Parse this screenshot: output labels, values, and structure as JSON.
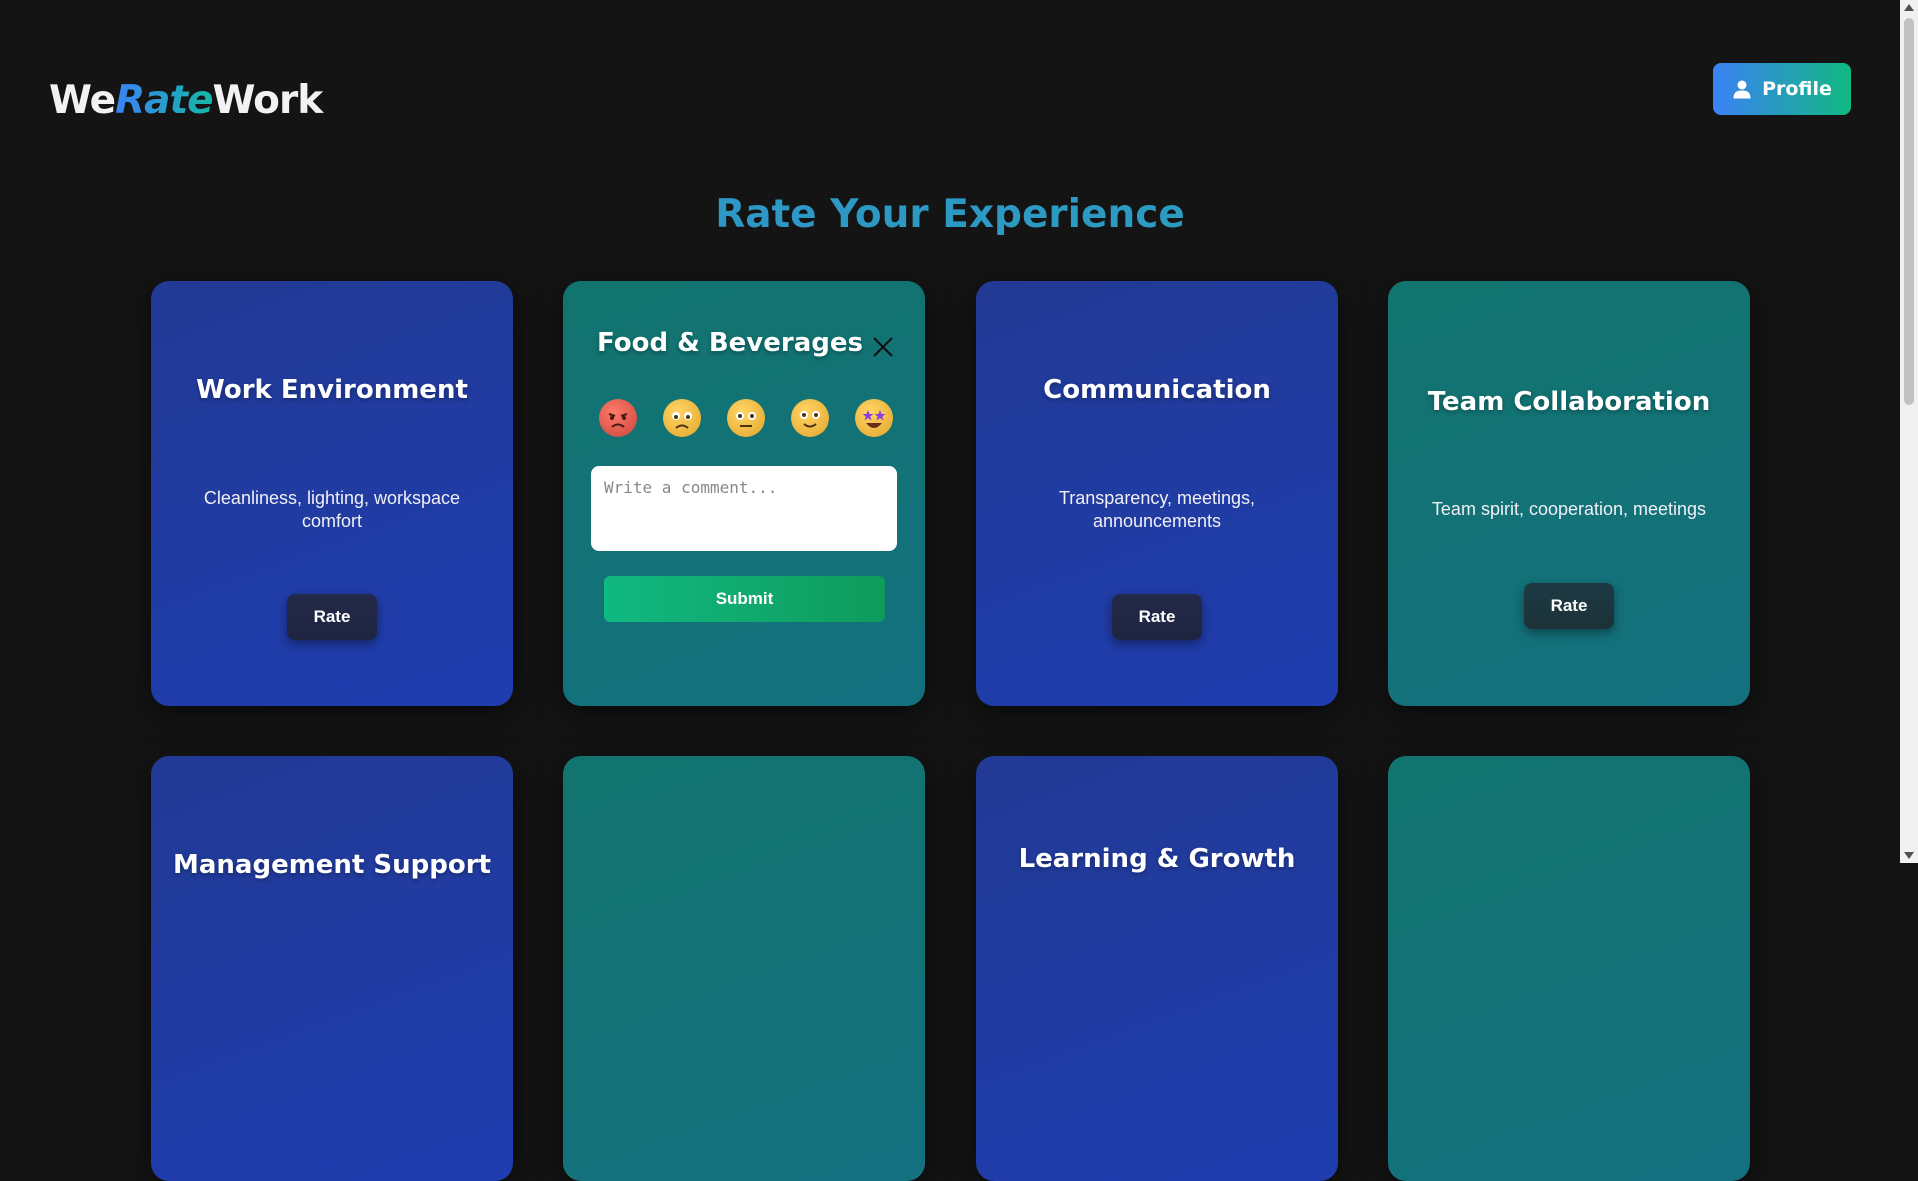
{
  "header": {
    "logo": {
      "part1": "We",
      "part2": "Rate",
      "part3": "Work"
    },
    "profile_label": "Profile"
  },
  "page_title": "Rate Your Experience",
  "cards": [
    {
      "title": "Work Environment",
      "desc": "Cleanliness, lighting, workspace comfort",
      "button": "Rate",
      "theme": "blue"
    },
    {
      "title": "Food & Beverages",
      "button": "Submit",
      "theme": "teal",
      "open": true,
      "comment_placeholder": "Write a comment...",
      "emojis": [
        "angry",
        "sad",
        "neutral",
        "smile",
        "star-struck"
      ]
    },
    {
      "title": "Communication",
      "desc": "Transparency, meetings, announcements",
      "button": "Rate",
      "theme": "blue"
    },
    {
      "title": "Team Collaboration",
      "desc": "Team spirit, cooperation, meetings",
      "button": "Rate",
      "theme": "teal"
    },
    {
      "title": "Management Support",
      "theme": "blue"
    },
    {
      "title": "",
      "theme": "teal"
    },
    {
      "title": "Learning & Growth",
      "theme": "blue"
    },
    {
      "title": "",
      "theme": "teal"
    }
  ],
  "colors": {
    "background": "#141414",
    "blue_card": "#1f3db0",
    "teal_card": "#13707f",
    "accent": "#2f8fcf"
  }
}
